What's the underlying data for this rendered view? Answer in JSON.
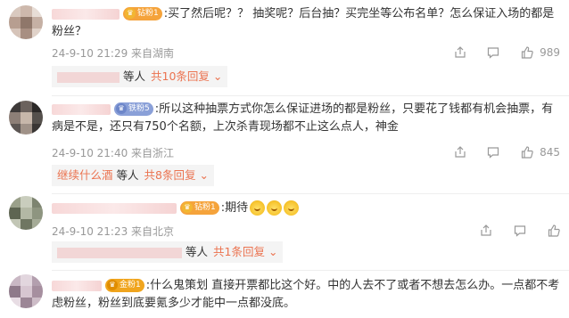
{
  "comments": [
    {
      "badge": "钻粉1",
      "text": ":买了然后呢？？ 抽奖呢？后台抽？买完坐等公布名单？怎么保证入场的都是粉丝？",
      "meta": "24-9-10 21:29 来自湖南",
      "like_count": "989",
      "reply_prefix": "等人",
      "reply_link": "共10条回复",
      "reply_name": ""
    },
    {
      "badge": "铁粉5",
      "text": ":所以这种抽票方式你怎么保证进场的都是粉丝，只要花了钱都有机会抽票，有病是不是，还只有750个名额，上次杀青现场都不止这么点人，神金",
      "meta": "24-9-10 21:40 来自浙江",
      "like_count": "845",
      "reply_prefix": "等人",
      "reply_link": "共8条回复",
      "reply_name": "继续什么酒"
    },
    {
      "badge": "钻粉1",
      "text": ":期待",
      "meta": "24-9-10 21:23 来自北京",
      "like_count": "",
      "reply_prefix": "等人",
      "reply_link": "共1条回复",
      "reply_name": ""
    },
    {
      "badge": "金粉1",
      "text": ":什么鬼策划 直接开票都比这个好。中的人去不了或者不想去怎么办。一点都不考虑粉丝，粉丝到底要氪多少才能中一点都没底。",
      "meta": "",
      "like_count": "",
      "reply_prefix": "",
      "reply_link": "",
      "reply_name": ""
    }
  ],
  "badge_colors": {
    "diamond": "#f5a33b",
    "iron": "#8aa0d8",
    "gold": "#f0a51e"
  },
  "accent": "#eb7350"
}
